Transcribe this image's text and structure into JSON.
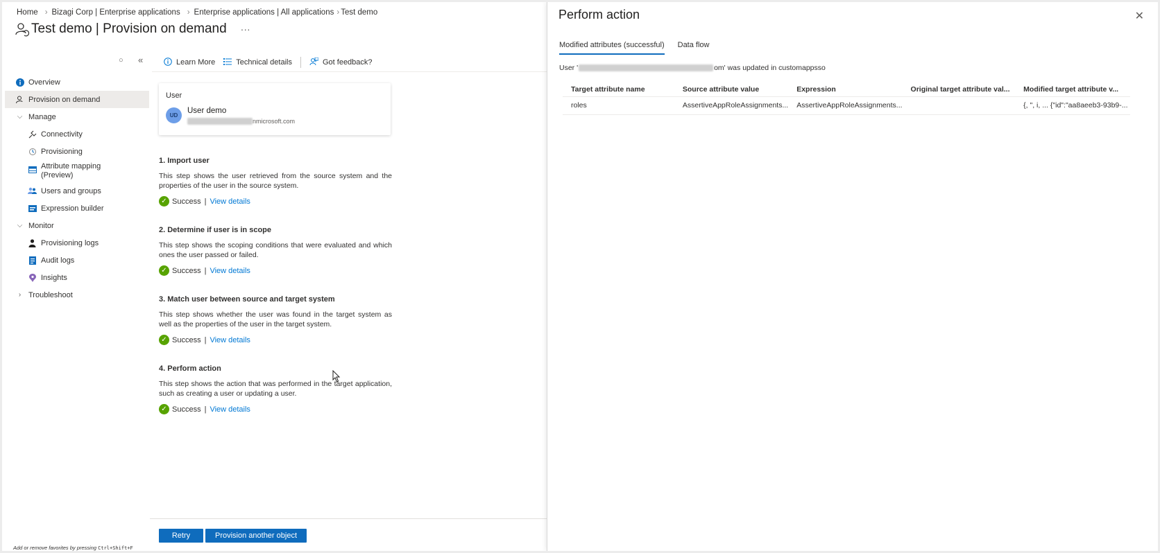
{
  "breadcrumb": {
    "items": [
      "Home",
      "Bizagi Corp | Enterprise applications",
      "Enterprise applications | All applications",
      "Test demo"
    ]
  },
  "page": {
    "title_part1": "Test demo",
    "title_sep": " | ",
    "title_part2": "Provision on demand",
    "more": "···",
    "collapse_icon": "«"
  },
  "sidebar": {
    "items": [
      {
        "label": "Overview",
        "icon": "info-icon"
      },
      {
        "label": "Provision on demand",
        "icon": "person-sync-icon"
      },
      {
        "label": "Manage",
        "icon": "chevron-down-icon"
      },
      {
        "label": "Connectivity",
        "icon": "plug-icon"
      },
      {
        "label": "Provisioning",
        "icon": "provisioning-icon"
      },
      {
        "label": "Attribute mapping (Preview)",
        "icon": "table-icon"
      },
      {
        "label": "Users and groups",
        "icon": "users-icon"
      },
      {
        "label": "Expression builder",
        "icon": "builder-icon"
      },
      {
        "label": "Monitor",
        "icon": "chevron-down-icon"
      },
      {
        "label": "Provisioning logs",
        "icon": "person-icon"
      },
      {
        "label": "Audit logs",
        "icon": "log-icon"
      },
      {
        "label": "Insights",
        "icon": "bulb-icon"
      },
      {
        "label": "Troubleshoot",
        "icon": "chevron-right-icon"
      }
    ]
  },
  "toolbar": {
    "learn_more": "Learn More",
    "technical_details": "Technical details",
    "feedback": "Got feedback?"
  },
  "user_card": {
    "label": "User",
    "initials": "UD",
    "name": "User demo",
    "email_suffix": "nmicrosoft.com"
  },
  "steps": [
    {
      "title": "1. Import user",
      "desc": "This step shows the user retrieved from the source system and the properties of the user in the source system.",
      "status": "Success",
      "link": "View details"
    },
    {
      "title": "2. Determine if user is in scope",
      "desc": "This step shows the scoping conditions that were evaluated and which ones the user passed or failed.",
      "status": "Success",
      "link": "View details"
    },
    {
      "title": "3. Match user between source and target system",
      "desc": "This step shows whether the user was found in the target system as well as the properties of the user in the target system.",
      "status": "Success",
      "link": "View details"
    },
    {
      "title": "4. Perform action",
      "desc": "This step shows the action that was performed in the target application, such as creating a user or updating a user.",
      "status": "Success",
      "link": "View details"
    }
  ],
  "footer": {
    "retry": "Retry",
    "provision_another": "Provision another object",
    "fav_hint_text": "Add or remove favorites by pressing ",
    "fav_hint_keys": "Ctrl+Shift+F"
  },
  "panel": {
    "title": "Perform action",
    "tabs": [
      "Modified attributes (successful)",
      "Data flow"
    ],
    "message_prefix": "User '",
    "message_suffix": "om' was updated in customappsso",
    "columns": [
      "Target attribute name",
      "Source attribute value",
      "Expression",
      "Original target attribute val...",
      "Modified target attribute v..."
    ],
    "rows": [
      [
        "roles",
        "AssertiveAppRoleAssignments...",
        "AssertiveAppRoleAssignments...",
        "",
        "{, \", i, ... {\"id\":\"aa8aeeb3-93b9-..."
      ]
    ]
  },
  "colors": {
    "accent": "#0f6cbd",
    "success": "#57a300",
    "link": "#0078d4"
  }
}
